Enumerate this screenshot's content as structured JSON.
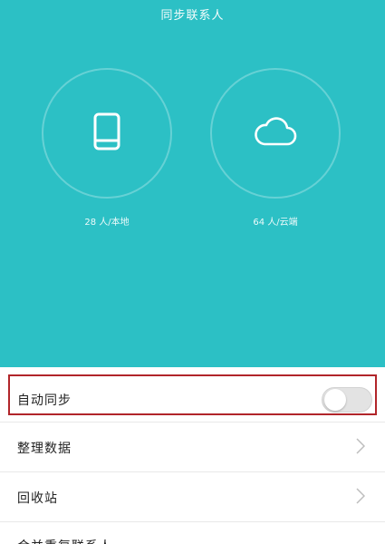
{
  "header": {
    "title": "同步联系人"
  },
  "stats": {
    "local": {
      "count_label": "28 人/本地",
      "icon": "phone-icon"
    },
    "cloud": {
      "count_label": "64 人/云端",
      "icon": "cloud-icon"
    }
  },
  "settings": {
    "auto_sync": {
      "label": "自动同步",
      "enabled": false
    },
    "organize": {
      "label": "整理数据"
    },
    "recycle": {
      "label": "回收站"
    },
    "partial": {
      "label": "合并重复联系人"
    }
  },
  "colors": {
    "accent": "#2cc0c5",
    "highlight": "#b1252a"
  }
}
